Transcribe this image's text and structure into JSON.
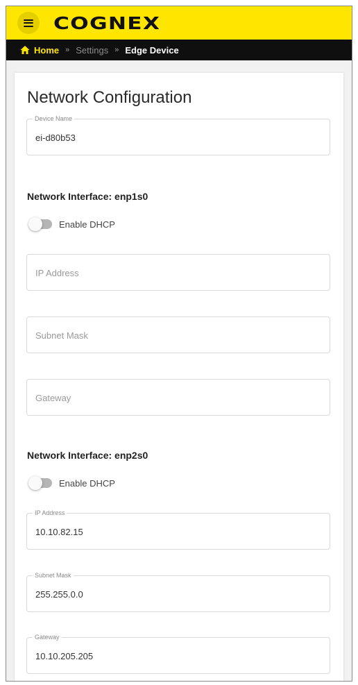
{
  "header": {
    "logo_text": "COGNEX",
    "brand_color": "#ffe600",
    "menu_icon": "hamburger-menu-icon"
  },
  "breadcrumb": {
    "home_icon": "home-icon",
    "home": "Home",
    "separator": "»",
    "settings": "Settings",
    "current": "Edge Device"
  },
  "page": {
    "title": "Network Configuration",
    "device_name": {
      "label": "Device Name",
      "value": "ei-d80b53"
    },
    "interfaces": [
      {
        "heading": "Network Interface: enp1s0",
        "dhcp_label": "Enable DHCP",
        "dhcp_enabled": false,
        "ip_address": {
          "label": "IP Address",
          "value": ""
        },
        "subnet_mask": {
          "label": "Subnet Mask",
          "value": ""
        },
        "gateway": {
          "label": "Gateway",
          "value": ""
        }
      },
      {
        "heading": "Network Interface: enp2s0",
        "dhcp_label": "Enable DHCP",
        "dhcp_enabled": false,
        "ip_address": {
          "label": "IP Address",
          "value": "10.10.82.15"
        },
        "subnet_mask": {
          "label": "Subnet Mask",
          "value": "255.255.0.0"
        },
        "gateway": {
          "label": "Gateway",
          "value": "10.10.205.205"
        }
      }
    ]
  }
}
